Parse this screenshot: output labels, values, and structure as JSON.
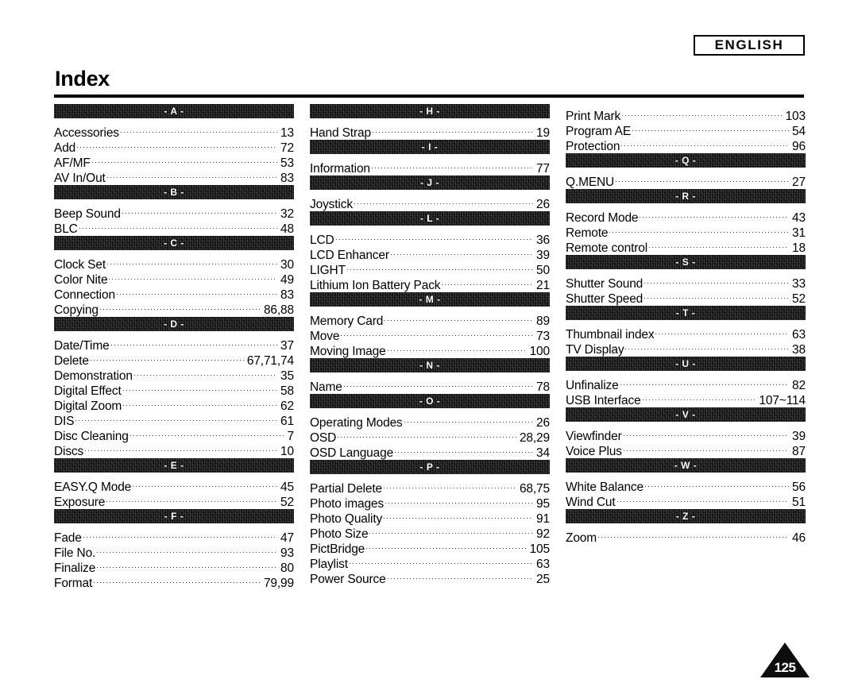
{
  "language_badge": "ENGLISH",
  "page_title": "Index",
  "page_number": "125",
  "columns": [
    {
      "sections": [
        {
          "letter": "- A -",
          "entries": [
            {
              "name": "Accessories",
              "page": "13"
            },
            {
              "name": "Add",
              "page": "72"
            },
            {
              "name": "AF/MF",
              "page": "53"
            },
            {
              "name": "AV In/Out",
              "page": "83"
            }
          ]
        },
        {
          "letter": "- B -",
          "entries": [
            {
              "name": "Beep Sound",
              "page": "32"
            },
            {
              "name": "BLC",
              "page": "48"
            }
          ]
        },
        {
          "letter": "- C -",
          "entries": [
            {
              "name": "Clock Set",
              "page": "30"
            },
            {
              "name": "Color Nite",
              "page": "49"
            },
            {
              "name": "Connection",
              "page": "83"
            },
            {
              "name": "Copying",
              "page": "86,88"
            }
          ]
        },
        {
          "letter": "- D -",
          "entries": [
            {
              "name": "Date/Time",
              "page": "37"
            },
            {
              "name": "Delete",
              "page": "67,71,74"
            },
            {
              "name": "Demonstration",
              "page": "35"
            },
            {
              "name": "Digital Effect",
              "page": "58"
            },
            {
              "name": "Digital Zoom",
              "page": "62"
            },
            {
              "name": "DIS",
              "page": "61"
            },
            {
              "name": "Disc Cleaning",
              "page": "7"
            },
            {
              "name": "Discs",
              "page": "10"
            }
          ]
        },
        {
          "letter": "- E -",
          "entries": [
            {
              "name": "EASY.Q Mode",
              "page": "45"
            },
            {
              "name": "Exposure",
              "page": "52"
            }
          ]
        },
        {
          "letter": "- F -",
          "entries": [
            {
              "name": "Fade",
              "page": "47"
            },
            {
              "name": "File No.",
              "page": "93"
            },
            {
              "name": "Finalize",
              "page": "80"
            },
            {
              "name": "Format",
              "page": "79,99"
            }
          ]
        }
      ]
    },
    {
      "sections": [
        {
          "letter": "- H -",
          "entries": [
            {
              "name": "Hand Strap",
              "page": "19"
            }
          ]
        },
        {
          "letter": "- I -",
          "entries": [
            {
              "name": "Information",
              "page": "77"
            }
          ]
        },
        {
          "letter": "- J -",
          "entries": [
            {
              "name": "Joystick",
              "page": "26"
            }
          ]
        },
        {
          "letter": "- L -",
          "entries": [
            {
              "name": "LCD",
              "page": "36"
            },
            {
              "name": "LCD Enhancer",
              "page": "39"
            },
            {
              "name": "LIGHT",
              "page": "50"
            },
            {
              "name": "Lithium Ion Battery Pack",
              "page": "21"
            }
          ]
        },
        {
          "letter": "- M -",
          "entries": [
            {
              "name": "Memory Card",
              "page": "89"
            },
            {
              "name": "Move",
              "page": "73"
            },
            {
              "name": "Moving Image",
              "page": "100"
            }
          ]
        },
        {
          "letter": "- N -",
          "entries": [
            {
              "name": "Name",
              "page": "78"
            }
          ]
        },
        {
          "letter": "- O -",
          "entries": [
            {
              "name": "Operating Modes",
              "page": "26"
            },
            {
              "name": "OSD",
              "page": "28,29"
            },
            {
              "name": "OSD Language",
              "page": "34"
            }
          ]
        },
        {
          "letter": "- P -",
          "entries": [
            {
              "name": "Partial Delete",
              "page": "68,75"
            },
            {
              "name": "Photo images",
              "page": "95"
            },
            {
              "name": "Photo Quality",
              "page": "91"
            },
            {
              "name": "Photo Size",
              "page": "92"
            },
            {
              "name": "PictBridge",
              "page": "105"
            },
            {
              "name": "Playlist",
              "page": "63"
            },
            {
              "name": "Power Source",
              "page": "25"
            }
          ]
        }
      ]
    },
    {
      "sections": [
        {
          "letter": null,
          "entries": [
            {
              "name": "Print Mark",
              "page": "103"
            },
            {
              "name": "Program AE",
              "page": "54"
            },
            {
              "name": "Protection",
              "page": "96"
            }
          ]
        },
        {
          "letter": "- Q -",
          "entries": [
            {
              "name": "Q.MENU",
              "page": "27"
            }
          ]
        },
        {
          "letter": "- R -",
          "entries": [
            {
              "name": "Record Mode",
              "page": "43"
            },
            {
              "name": "Remote",
              "page": "31"
            },
            {
              "name": "Remote control",
              "page": "18"
            }
          ]
        },
        {
          "letter": "- S -",
          "entries": [
            {
              "name": "Shutter Sound",
              "page": "33"
            },
            {
              "name": "Shutter Speed",
              "page": "52"
            }
          ]
        },
        {
          "letter": "- T -",
          "entries": [
            {
              "name": "Thumbnail index",
              "page": "63"
            },
            {
              "name": "TV Display",
              "page": "38"
            }
          ]
        },
        {
          "letter": "- U -",
          "entries": [
            {
              "name": "Unfinalize",
              "page": "82"
            },
            {
              "name": "USB Interface",
              "page": "107~114"
            }
          ]
        },
        {
          "letter": "- V -",
          "entries": [
            {
              "name": "Viewfinder",
              "page": "39"
            },
            {
              "name": "Voice Plus",
              "page": "87"
            }
          ]
        },
        {
          "letter": "- W -",
          "entries": [
            {
              "name": "White Balance",
              "page": "56"
            },
            {
              "name": "Wind Cut",
              "page": "51"
            }
          ]
        },
        {
          "letter": "- Z -",
          "entries": [
            {
              "name": "Zoom",
              "page": "46"
            }
          ]
        }
      ]
    }
  ]
}
